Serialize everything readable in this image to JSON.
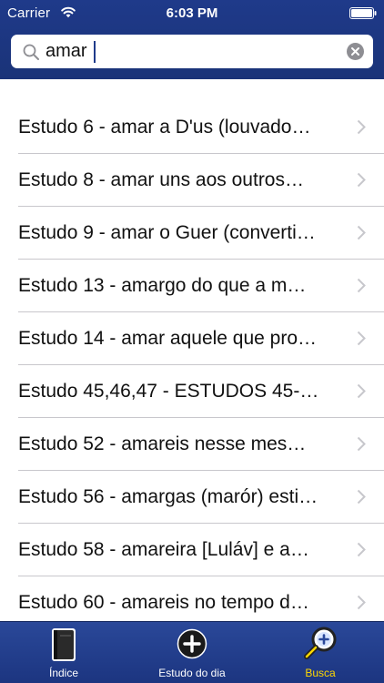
{
  "status_bar": {
    "carrier": "Carrier",
    "time": "6:03 PM"
  },
  "search": {
    "value": "amar",
    "placeholder": ""
  },
  "results": [
    {
      "label": "Estudo 6 - amar a D'us (louvado…"
    },
    {
      "label": "Estudo 8 - amar uns aos outros…"
    },
    {
      "label": "Estudo 9 - amar o Guer (converti…"
    },
    {
      "label": "Estudo 13 - amargo do que a m…"
    },
    {
      "label": "Estudo 14 - amar aquele que pro…"
    },
    {
      "label": "Estudo 45,46,47 - ESTUDOS 45-…"
    },
    {
      "label": "Estudo 52 - amareis nesse mes…"
    },
    {
      "label": "Estudo 56 - amargas (marór) esti…"
    },
    {
      "label": "Estudo 58 - amareira [Luláv] e a…"
    },
    {
      "label": "Estudo 60 - amareis no tempo d…"
    }
  ],
  "tab_bar": {
    "tabs": [
      {
        "label": "Índice",
        "icon": "book-icon",
        "active": false
      },
      {
        "label": "Estudo do dia",
        "icon": "plus-circle-icon",
        "active": false
      },
      {
        "label": "Busca",
        "icon": "magnifier-icon",
        "active": true
      }
    ]
  },
  "colors": {
    "bar_blue": "#1f3a8a",
    "active_tab": "#ffd800",
    "separator": "#c8c7cc",
    "chevron": "#c7c7cc"
  }
}
